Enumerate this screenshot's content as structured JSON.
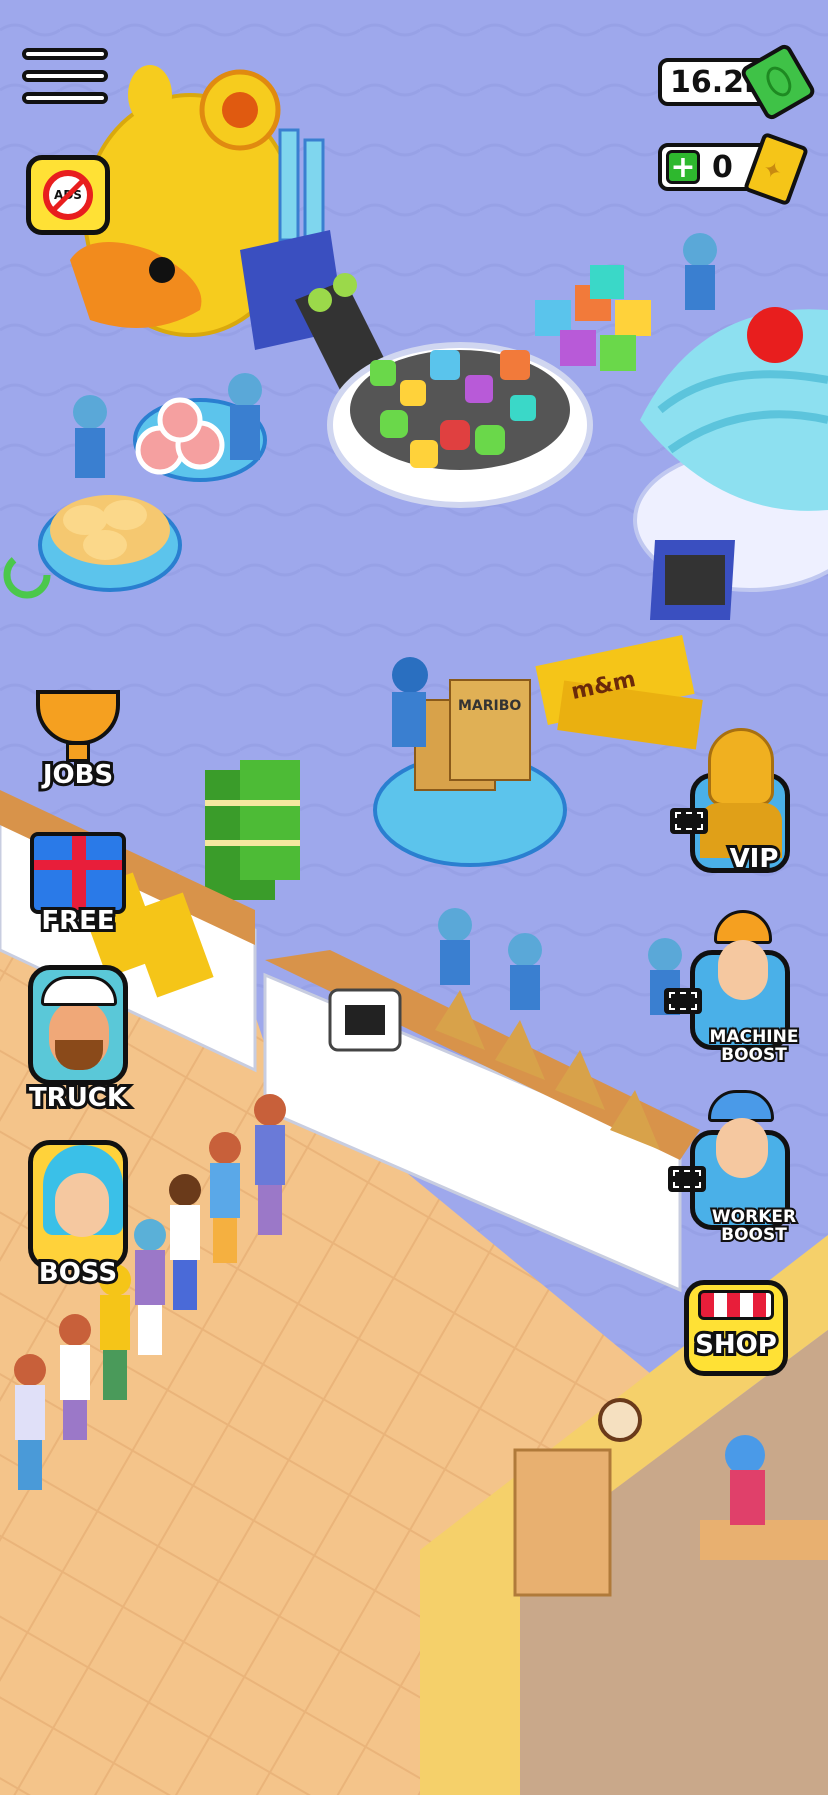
{
  "hud": {
    "money": "16.2K",
    "tickets": "0"
  },
  "left_menu": {
    "jobs_label": "JOBS",
    "free_label": "FREE",
    "truck_label": "TRUCK",
    "boss_label": "BOSS"
  },
  "right_menu": {
    "vip_label": "VIP",
    "machine_boost_label": "MACHINE\nBOOST",
    "worker_boost_label": "WORKER\nBOOST",
    "shop_label": "SHOP"
  },
  "ads_button_text": "ADS",
  "products": {
    "box_brand": "MARIBO",
    "pack_brand": "m&m"
  },
  "colors": {
    "floor": "#9ea8ec",
    "wood_floor": "#f4c48a",
    "money_green": "#3fc247",
    "ticket_gold": "#f5c518",
    "worker_blue": "#3a7fd0"
  }
}
